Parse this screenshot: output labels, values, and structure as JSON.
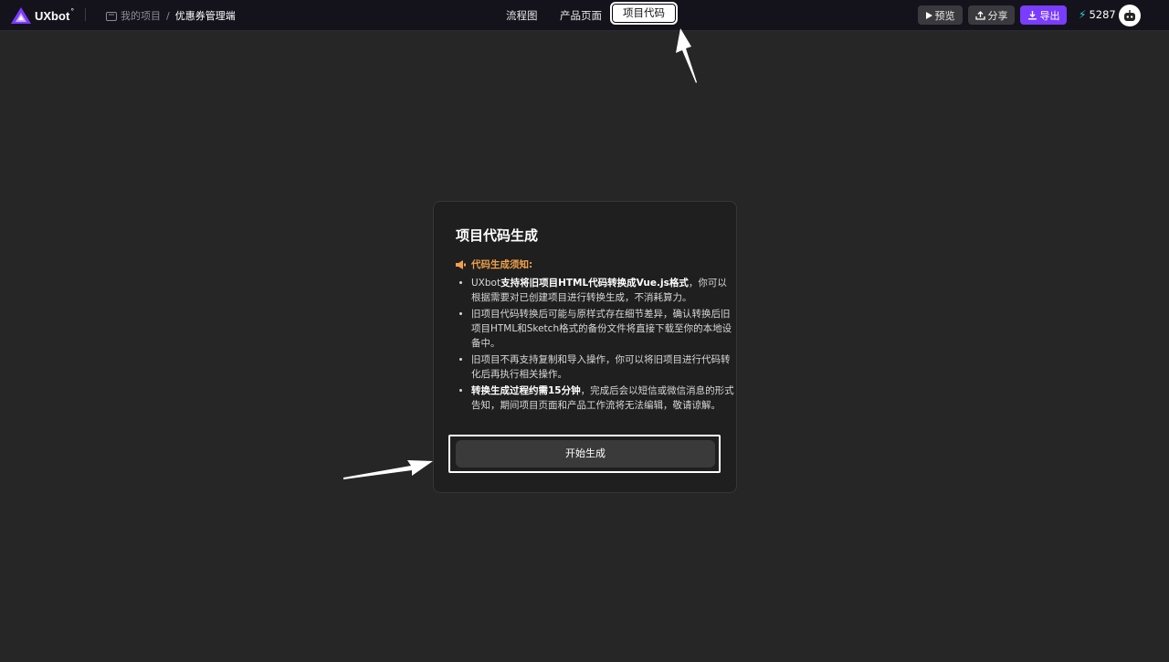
{
  "app": {
    "logo_text": "UXbot",
    "logo_mark": "°"
  },
  "breadcrumb": {
    "parent": "我的项目",
    "separator": "/",
    "current": "优惠券管理端"
  },
  "nav": {
    "tabs": [
      {
        "label": "流程图"
      },
      {
        "label": "产品页面"
      },
      {
        "label": "项目代码",
        "active": true
      }
    ]
  },
  "toolbar": {
    "preview_label": "预览",
    "share_label": "分享",
    "export_label": "导出",
    "credits": "5287"
  },
  "dialog": {
    "title": "项目代码生成",
    "notice_title": "代码生成须知:",
    "items": [
      {
        "pre": "UXbot",
        "bold": "支持将旧项目HTML代码转换成Vue.js格式",
        "post": "，你可以根据需要对已创建项目进行转换生成，不消耗算力。"
      },
      {
        "pre": "旧项目代码转换后可能与原样式存在细节差异，确认转换后旧项目HTML和Sketch格式的备份文件将直接下载至你的本地设备中。",
        "bold": "",
        "post": ""
      },
      {
        "pre": "旧项目不再支持复制和导入操作，你可以将旧项目进行代码转化后再执行相关操作。",
        "bold": "",
        "post": ""
      },
      {
        "pre": "",
        "bold": "转换生成过程约需15分钟",
        "post": "，完成后会以短信或微信消息的形式告知，期间项目页面和产品工作流将无法编辑，敬请谅解。"
      }
    ],
    "start_button": "开始生成"
  },
  "colors": {
    "background": "#262626",
    "topbar": "#14131c",
    "accent": "#7a3cff",
    "notice": "#f0a04a"
  }
}
